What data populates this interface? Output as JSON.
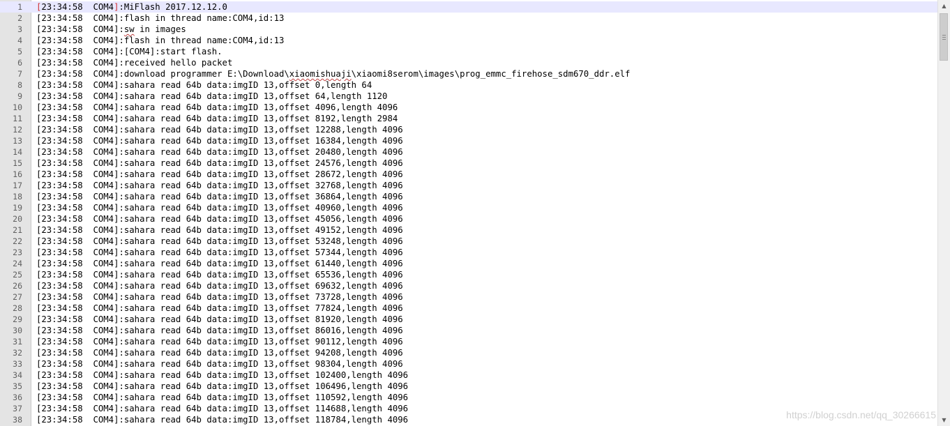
{
  "colors": {
    "gutter_bg": "#e4e4e4",
    "current_line_bg": "#e8e8ff",
    "bracket_current": "#d03030",
    "scrollbar_bg": "#f0f0f0"
  },
  "log_lines": [
    {
      "num": "1",
      "prefix": "[23:34:58  COM4]",
      "text": ":MiFlash 2017.12.12.0"
    },
    {
      "num": "2",
      "prefix": "[23:34:58  COM4]",
      "text": ":flash in thread name:COM4,id:13"
    },
    {
      "num": "3",
      "prefix": "[23:34:58  COM4]",
      "text": ":",
      "squiggle": "sw",
      "after": " in images"
    },
    {
      "num": "4",
      "prefix": "[23:34:58  COM4]",
      "text": ":flash in thread name:COM4,id:13"
    },
    {
      "num": "5",
      "prefix": "[23:34:58  COM4]",
      "text": ":[COM4]:start flash."
    },
    {
      "num": "6",
      "prefix": "[23:34:58  COM4]",
      "text": ":received hello packet"
    },
    {
      "num": "7",
      "prefix": "[23:34:58  COM4]",
      "text": ":download programmer E:\\Download\\",
      "squiggle": "xiaomishuaji",
      "after": "\\xiaomi8serom\\images\\prog_emmc_firehose_sdm670_ddr.elf"
    },
    {
      "num": "8",
      "prefix": "[23:34:58  COM4]",
      "text": ":sahara read 64b data:imgID 13,offset 0,length 64"
    },
    {
      "num": "9",
      "prefix": "[23:34:58  COM4]",
      "text": ":sahara read 64b data:imgID 13,offset 64,length 1120"
    },
    {
      "num": "10",
      "prefix": "[23:34:58  COM4]",
      "text": ":sahara read 64b data:imgID 13,offset 4096,length 4096"
    },
    {
      "num": "11",
      "prefix": "[23:34:58  COM4]",
      "text": ":sahara read 64b data:imgID 13,offset 8192,length 2984"
    },
    {
      "num": "12",
      "prefix": "[23:34:58  COM4]",
      "text": ":sahara read 64b data:imgID 13,offset 12288,length 4096"
    },
    {
      "num": "13",
      "prefix": "[23:34:58  COM4]",
      "text": ":sahara read 64b data:imgID 13,offset 16384,length 4096"
    },
    {
      "num": "14",
      "prefix": "[23:34:58  COM4]",
      "text": ":sahara read 64b data:imgID 13,offset 20480,length 4096"
    },
    {
      "num": "15",
      "prefix": "[23:34:58  COM4]",
      "text": ":sahara read 64b data:imgID 13,offset 24576,length 4096"
    },
    {
      "num": "16",
      "prefix": "[23:34:58  COM4]",
      "text": ":sahara read 64b data:imgID 13,offset 28672,length 4096"
    },
    {
      "num": "17",
      "prefix": "[23:34:58  COM4]",
      "text": ":sahara read 64b data:imgID 13,offset 32768,length 4096"
    },
    {
      "num": "18",
      "prefix": "[23:34:58  COM4]",
      "text": ":sahara read 64b data:imgID 13,offset 36864,length 4096"
    },
    {
      "num": "19",
      "prefix": "[23:34:58  COM4]",
      "text": ":sahara read 64b data:imgID 13,offset 40960,length 4096"
    },
    {
      "num": "20",
      "prefix": "[23:34:58  COM4]",
      "text": ":sahara read 64b data:imgID 13,offset 45056,length 4096"
    },
    {
      "num": "21",
      "prefix": "[23:34:58  COM4]",
      "text": ":sahara read 64b data:imgID 13,offset 49152,length 4096"
    },
    {
      "num": "22",
      "prefix": "[23:34:58  COM4]",
      "text": ":sahara read 64b data:imgID 13,offset 53248,length 4096"
    },
    {
      "num": "23",
      "prefix": "[23:34:58  COM4]",
      "text": ":sahara read 64b data:imgID 13,offset 57344,length 4096"
    },
    {
      "num": "24",
      "prefix": "[23:34:58  COM4]",
      "text": ":sahara read 64b data:imgID 13,offset 61440,length 4096"
    },
    {
      "num": "25",
      "prefix": "[23:34:58  COM4]",
      "text": ":sahara read 64b data:imgID 13,offset 65536,length 4096"
    },
    {
      "num": "26",
      "prefix": "[23:34:58  COM4]",
      "text": ":sahara read 64b data:imgID 13,offset 69632,length 4096"
    },
    {
      "num": "27",
      "prefix": "[23:34:58  COM4]",
      "text": ":sahara read 64b data:imgID 13,offset 73728,length 4096"
    },
    {
      "num": "28",
      "prefix": "[23:34:58  COM4]",
      "text": ":sahara read 64b data:imgID 13,offset 77824,length 4096"
    },
    {
      "num": "29",
      "prefix": "[23:34:58  COM4]",
      "text": ":sahara read 64b data:imgID 13,offset 81920,length 4096"
    },
    {
      "num": "30",
      "prefix": "[23:34:58  COM4]",
      "text": ":sahara read 64b data:imgID 13,offset 86016,length 4096"
    },
    {
      "num": "31",
      "prefix": "[23:34:58  COM4]",
      "text": ":sahara read 64b data:imgID 13,offset 90112,length 4096"
    },
    {
      "num": "32",
      "prefix": "[23:34:58  COM4]",
      "text": ":sahara read 64b data:imgID 13,offset 94208,length 4096"
    },
    {
      "num": "33",
      "prefix": "[23:34:58  COM4]",
      "text": ":sahara read 64b data:imgID 13,offset 98304,length 4096"
    },
    {
      "num": "34",
      "prefix": "[23:34:58  COM4]",
      "text": ":sahara read 64b data:imgID 13,offset 102400,length 4096"
    },
    {
      "num": "35",
      "prefix": "[23:34:58  COM4]",
      "text": ":sahara read 64b data:imgID 13,offset 106496,length 4096"
    },
    {
      "num": "36",
      "prefix": "[23:34:58  COM4]",
      "text": ":sahara read 64b data:imgID 13,offset 110592,length 4096"
    },
    {
      "num": "37",
      "prefix": "[23:34:58  COM4]",
      "text": ":sahara read 64b data:imgID 13,offset 114688,length 4096"
    },
    {
      "num": "38",
      "prefix": "[23:34:58  COM4]",
      "text": ":sahara read 64b data:imgID 13,offset 118784,length 4096"
    }
  ],
  "scrollbar": {
    "up_icon": "▲",
    "down_icon": "▼",
    "position_fraction": 0.0
  },
  "watermark": "https://blog.csdn.net/qq_30266615"
}
